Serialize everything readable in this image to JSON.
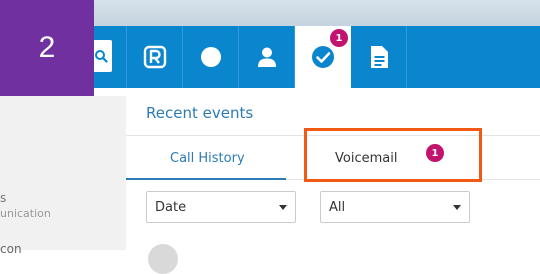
{
  "step_badge": "2",
  "nav": {
    "voicemail_badge": "1"
  },
  "sidebar": {
    "fragment_1": "s",
    "fragment_2": "unication",
    "fragment_3": "con"
  },
  "section_title": "Recent events",
  "tabs": [
    {
      "label": "Call History",
      "active": true
    },
    {
      "label": "Voicemail",
      "active": false,
      "badge": "1"
    }
  ],
  "filters": {
    "date_select": "Date",
    "type_select": "All"
  },
  "colors": {
    "nav_blue": "#0a86cf",
    "accent_blue": "#2c7bb6",
    "badge_pink": "#c2136e",
    "step_purple": "#7030a0",
    "highlight_orange": "#f25a14"
  }
}
